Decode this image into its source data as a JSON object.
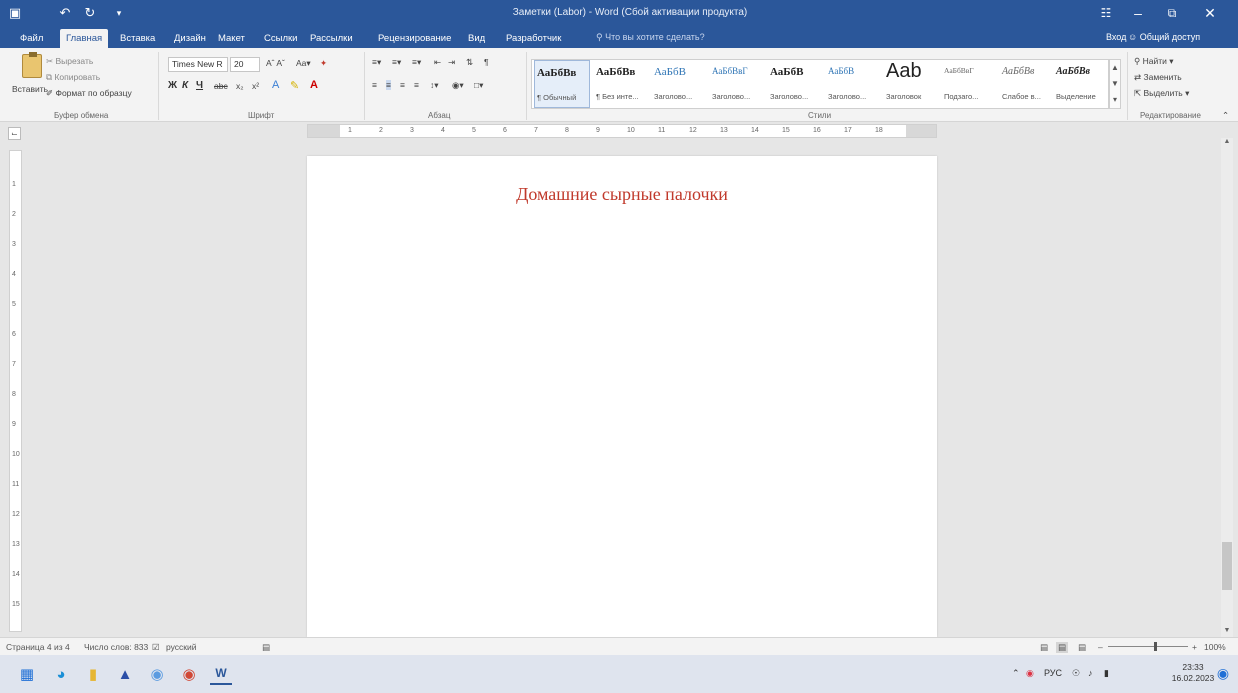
{
  "window": {
    "title": "Заметки (Labor) - Word (Сбой активации продукта)",
    "quick_access": {
      "save_icon": "save-icon",
      "undo_icon": "undo-icon",
      "redo_icon": "redo-icon",
      "customize_icon": "customize-icon"
    },
    "controls": {
      "ribbon_display": "ribbon-display-icon",
      "minimize": "minimize-icon",
      "maximize": "maximize-icon",
      "close": "close-icon"
    }
  },
  "tabs": [
    {
      "label": "Файл"
    },
    {
      "label": "Главная"
    },
    {
      "label": "Вставка"
    },
    {
      "label": "Дизайн"
    },
    {
      "label": "Макет"
    },
    {
      "label": "Ссылки"
    },
    {
      "label": "Рассылки"
    },
    {
      "label": "Рецензирование"
    },
    {
      "label": "Вид"
    },
    {
      "label": "Разработчик"
    }
  ],
  "tell_me": "Что вы хотите сделать?",
  "account": {
    "signin": "Вход",
    "share": "Общий доступ"
  },
  "clipboard": {
    "paste": "Вставить",
    "cut": "Вырезать",
    "copy": "Копировать",
    "format_painter": "Формат по образцу",
    "group_label": "Буфер обмена"
  },
  "font": {
    "name": "Times New R",
    "size": "20",
    "group_label": "Шрифт",
    "buttons": {
      "bold": "Ж",
      "italic": "К",
      "underline": "Ч",
      "strike": "abc",
      "sub": "x₂",
      "sup": "x²"
    }
  },
  "paragraph": {
    "group_label": "Абзац"
  },
  "styles": {
    "group_label": "Стили",
    "items": [
      {
        "sample": "АаБбВв",
        "name": "¶ Обычный"
      },
      {
        "sample": "АаБбВв",
        "name": "¶ Без инте..."
      },
      {
        "sample": "АаБбВ",
        "name": "Заголово..."
      },
      {
        "sample": "АаБбВвГ",
        "name": "Заголово..."
      },
      {
        "sample": "АаБбВ",
        "name": "Заголово..."
      },
      {
        "sample": "АаБбВ",
        "name": "Заголово..."
      },
      {
        "sample": "Aab",
        "name": "Заголовок"
      },
      {
        "sample": "АаБбВвГ",
        "name": "Подзаго..."
      },
      {
        "sample": "АаБбВв",
        "name": "Слабое в..."
      },
      {
        "sample": "АаБбВв",
        "name": "Выделение"
      }
    ]
  },
  "editing": {
    "group_label": "Редактирование",
    "find": "Найти",
    "replace": "Заменить",
    "select": "Выделить"
  },
  "ruler_numbers": [
    "1",
    "2",
    "3",
    "4",
    "5",
    "6",
    "7",
    "8",
    "9",
    "10",
    "11",
    "12",
    "13",
    "14",
    "15",
    "16",
    "17",
    "18"
  ],
  "vruler_numbers": [
    "1",
    "2",
    "3",
    "4",
    "5",
    "6",
    "7",
    "8",
    "9",
    "10",
    "11",
    "12",
    "13",
    "14",
    "15"
  ],
  "document": {
    "title": "Домашние сырные палочки",
    "title_color": "#c0392b"
  },
  "status": {
    "page": "Страница 4 из 4",
    "words": "Число слов: 833",
    "language": "русский"
  },
  "zoom": {
    "level": "100%"
  },
  "taskbar": {
    "icons": [
      "windows-icon",
      "edge-icon",
      "explorer-icon",
      "app-icon",
      "store-icon",
      "chrome-icon",
      "word-icon"
    ],
    "lang": "РУС",
    "time": "23:33",
    "date": "16.02.2023"
  },
  "colors": {
    "accent": "#2b579a",
    "ribbon": "#f3f3f3",
    "doc_title": "#c0392b"
  }
}
